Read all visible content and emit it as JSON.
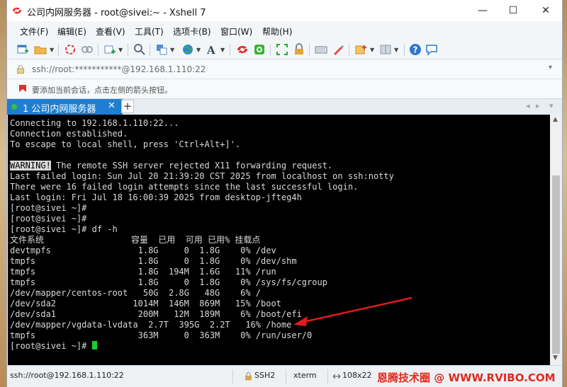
{
  "window": {
    "title": "公司内网服务器 - root@sivei:~ - Xshell 7",
    "controls": {
      "minimize": "—",
      "maximize": "☐",
      "close": "✕"
    }
  },
  "menu": {
    "items": [
      "文件(F)",
      "编辑(E)",
      "查看(V)",
      "工具(T)",
      "选项卡(B)",
      "窗口(W)",
      "帮助(H)"
    ]
  },
  "toolbar": {
    "icons": [
      "new-session-icon",
      "open-folder-icon",
      "reconnect-icon",
      "disconnect-icon",
      "new-tab-icon",
      "find-icon",
      "transfer-icon",
      "globe-icon",
      "font-icon",
      "xftp-icon",
      "xmanager-icon",
      "fullscreen-icon",
      "lock-icon",
      "keyboard-icon",
      "highlight-icon",
      "compose-icon",
      "layout-icon",
      "help-icon",
      "chat-icon"
    ]
  },
  "address": {
    "text": "ssh://root:***********@192.168.1.110:22",
    "dropdown": "▾"
  },
  "hint": {
    "text": "要添加当前会话，点击左侧的箭头按钮。"
  },
  "tabs": {
    "active": {
      "label": "1 公司内网服务器",
      "close": "✕"
    },
    "add": "+",
    "nav_left": "◂",
    "nav_right": "▸",
    "nav_menu": "▾"
  },
  "terminal": {
    "lines": [
      "Connecting to 192.168.1.110:22...",
      "Connection established.",
      "To escape to local shell, press 'Ctrl+Alt+]'.",
      "",
      "WARNING!",
      "Last failed login: Sun Jul 20 21:39:20 CST 2025 from localhost on ssh:notty",
      "There were 16 failed login attempts since the last successful login.",
      "Last login: Fri Jul 18 16:00:39 2025 from desktop-jfteg4h",
      "[root@sivei ~]#",
      "[root@sivei ~]#",
      "[root@sivei ~]# df -h",
      "文件系统                 容量  已用  可用 已用% 挂载点",
      "devtmpfs                 1.8G     0  1.8G    0% /dev",
      "tmpfs                    1.8G     0  1.8G    0% /dev/shm",
      "tmpfs                    1.8G  194M  1.6G   11% /run",
      "tmpfs                    1.8G     0  1.8G    0% /sys/fs/cgroup",
      "/dev/mapper/centos-root   50G  2.8G   48G    6% /",
      "/dev/sda2               1014M  146M  869M   15% /boot",
      "/dev/sda1                200M   12M  189M    6% /boot/efi",
      "/dev/mapper/vgdata-lvdata  2.7T  395G  2.2T   16% /home",
      "tmpfs                    363M     0  363M    0% /run/user/0",
      "[root@sivei ~]# "
    ],
    "warning_rest": " The remote SSH server rejected X11 forwarding request.",
    "annotation_color": "#e11b1b"
  },
  "status": {
    "connection": "ssh://root@192.168.1.110:22",
    "protocol": "SSH2",
    "terminal_type": "xterm",
    "size": "108x22",
    "watermark": "恩腾技术圈 @ WWW.RVIBO.COM"
  },
  "colors": {
    "tab_accent": "#1f7ed1",
    "terminal_bg": "#000000",
    "terminal_fg": "#d9d9d9",
    "cursor": "#18d12a",
    "watermark": "#e02a1f"
  }
}
